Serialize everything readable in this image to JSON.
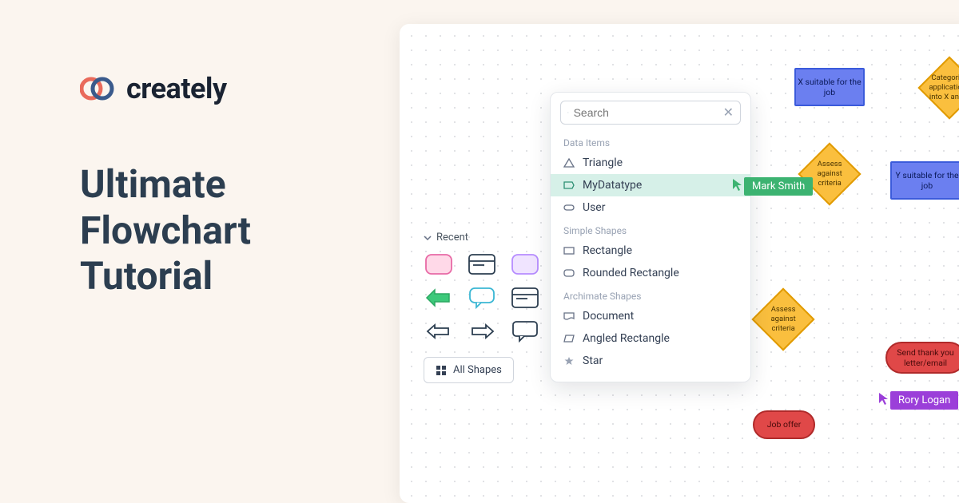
{
  "brand": "creately",
  "headline_l1": "Ultimate",
  "headline_l2": "Flowchart",
  "headline_l3": "Tutorial",
  "palette": {
    "header": "Recent",
    "all_shapes": "All Shapes"
  },
  "dropdown": {
    "search_placeholder": "Search",
    "groups": [
      {
        "label": "Data Items",
        "items": [
          {
            "icon": "triangle",
            "label": "Triangle",
            "selected": false
          },
          {
            "icon": "flag",
            "label": "MyDatatype",
            "selected": true
          },
          {
            "icon": "pill",
            "label": "User",
            "selected": false
          }
        ]
      },
      {
        "label": "Simple Shapes",
        "items": [
          {
            "icon": "rect",
            "label": "Rectangle",
            "selected": false
          },
          {
            "icon": "roundrect",
            "label": "Rounded Rectangle",
            "selected": false
          }
        ]
      },
      {
        "label": "Archimate Shapes",
        "items": [
          {
            "icon": "doc",
            "label": "Document",
            "selected": false
          },
          {
            "icon": "angled",
            "label": "Angled Rectangle",
            "selected": false
          },
          {
            "icon": "star",
            "label": "Star",
            "selected": false
          }
        ]
      }
    ]
  },
  "cursors": {
    "green": "Mark Smith",
    "purple": "Rory Logan"
  },
  "flow": {
    "n1": "X suitable for the job",
    "n2": "Categorize applications into X and Y",
    "n3": "Assess against criteria",
    "n4": "Y suitable for the job",
    "n5": "Assess against criteria",
    "n6": "Send thank you letter/email",
    "n7": "Job offer"
  }
}
